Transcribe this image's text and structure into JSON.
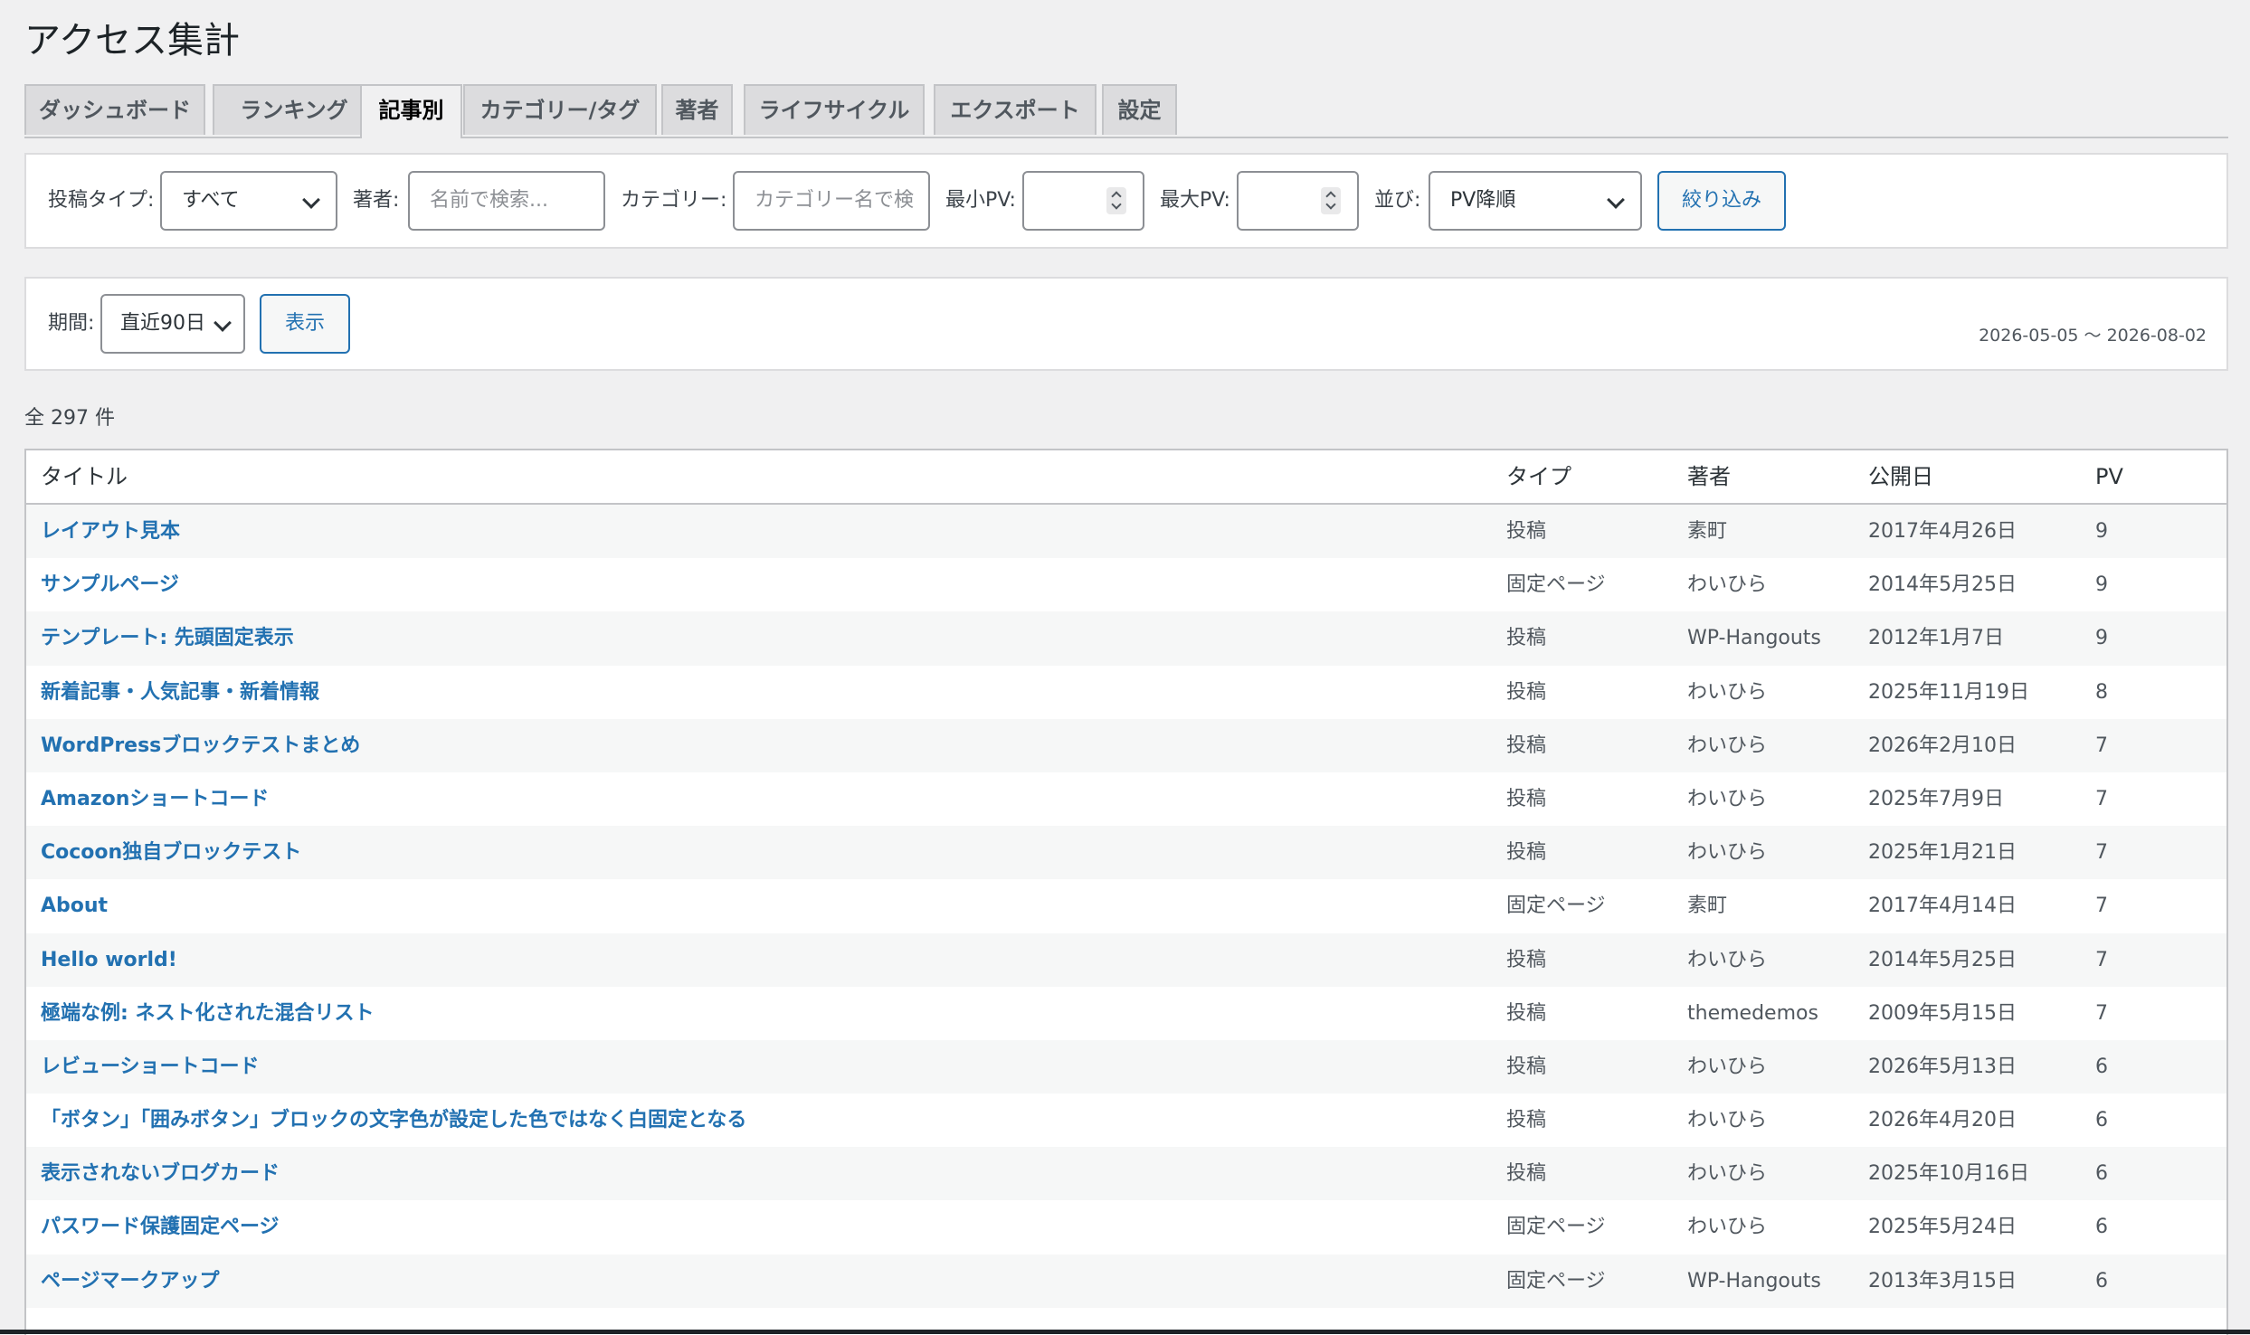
{
  "page_title": "アクセス集計",
  "tabs": [
    {
      "label": "ダッシュボード"
    },
    {
      "label": "ランキング"
    },
    {
      "label": "記事別"
    },
    {
      "label": "カテゴリー/タグ"
    },
    {
      "label": "著者"
    },
    {
      "label": "ライフサイクル"
    },
    {
      "label": "エクスポート"
    },
    {
      "label": "設定"
    }
  ],
  "active_tab": "記事別",
  "filters": {
    "post_type_label": "投稿タイプ:",
    "post_type_value": "すべて",
    "author_label": "著者:",
    "author_placeholder": "名前で検索...",
    "category_label": "カテゴリー:",
    "category_placeholder": "カテゴリー名で検",
    "min_pv_label": "最小PV:",
    "max_pv_label": "最大PV:",
    "sort_label": "並び:",
    "sort_value": "PV降順",
    "filter_button": "絞り込み"
  },
  "period": {
    "label": "期間:",
    "value": "直近90日",
    "show_button": "表示",
    "range": "2026-05-05 〜 2026-08-02"
  },
  "total_count": "全 297 件",
  "table": {
    "columns": [
      "タイトル",
      "タイプ",
      "著者",
      "公開日",
      "PV"
    ],
    "rows": [
      {
        "title": "レイアウト見本",
        "type": "投稿",
        "author": "素町",
        "date": "2017年4月26日",
        "pv": "9"
      },
      {
        "title": "サンプルページ",
        "type": "固定ページ",
        "author": "わいひら",
        "date": "2014年5月25日",
        "pv": "9"
      },
      {
        "title": "テンプレート: 先頭固定表示",
        "type": "投稿",
        "author": "WP-Hangouts",
        "date": "2012年1月7日",
        "pv": "9"
      },
      {
        "title": "新着記事・人気記事・新着情報",
        "type": "投稿",
        "author": "わいひら",
        "date": "2025年11月19日",
        "pv": "8"
      },
      {
        "title": "WordPressブロックテストまとめ",
        "type": "投稿",
        "author": "わいひら",
        "date": "2026年2月10日",
        "pv": "7"
      },
      {
        "title": "Amazonショートコード",
        "type": "投稿",
        "author": "わいひら",
        "date": "2025年7月9日",
        "pv": "7"
      },
      {
        "title": "Cocoon独自ブロックテスト",
        "type": "投稿",
        "author": "わいひら",
        "date": "2025年1月21日",
        "pv": "7"
      },
      {
        "title": "About",
        "type": "固定ページ",
        "author": "素町",
        "date": "2017年4月14日",
        "pv": "7"
      },
      {
        "title": "Hello world!",
        "type": "投稿",
        "author": "わいひら",
        "date": "2014年5月25日",
        "pv": "7"
      },
      {
        "title": "極端な例: ネスト化された混合リスト",
        "type": "投稿",
        "author": "themedemos",
        "date": "2009年5月15日",
        "pv": "7"
      },
      {
        "title": "レビューショートコード",
        "type": "投稿",
        "author": "わいひら",
        "date": "2026年5月13日",
        "pv": "6"
      },
      {
        "title": "「ボタン」「囲みボタン」ブロックの文字色が設定した色ではなく白固定となる",
        "type": "投稿",
        "author": "わいひら",
        "date": "2026年4月20日",
        "pv": "6"
      },
      {
        "title": "表示されないブログカード",
        "type": "投稿",
        "author": "わいひら",
        "date": "2025年10月16日",
        "pv": "6"
      },
      {
        "title": "パスワード保護固定ページ",
        "type": "固定ページ",
        "author": "わいひら",
        "date": "2025年5月24日",
        "pv": "6"
      },
      {
        "title": "ページマークアップ",
        "type": "固定ページ",
        "author": "WP-Hangouts",
        "date": "2013年3月15日",
        "pv": "6"
      }
    ]
  },
  "colors": {
    "link": "#2271b1",
    "background": "#f0f0f1",
    "panel": "#ffffff",
    "stripe": "#f6f7f7"
  }
}
